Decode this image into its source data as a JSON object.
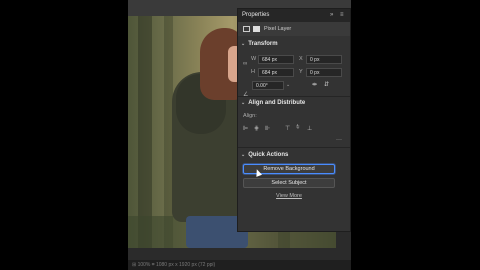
{
  "panel": {
    "title": "Properties",
    "collapse_icon": "double-chevron-icon",
    "menu_icon": "hamburger-icon",
    "layer_type": "Pixel Layer"
  },
  "transform": {
    "title": "Transform",
    "width_label": "W",
    "width_value": "684 px",
    "height_label": "H",
    "height_value": "684 px",
    "x_label": "X",
    "x_value": "0 px",
    "y_label": "Y",
    "y_value": "0 px",
    "angle_value": "0.00°"
  },
  "align": {
    "title": "Align and Distribute",
    "label": "Align:"
  },
  "quick_actions": {
    "title": "Quick Actions",
    "remove_background": "Remove Background",
    "select_subject": "Select Subject",
    "view_more": "View More"
  },
  "status": {
    "text": "⊞ 100% ⌗ 1080 px x 1920 px (72 ppi)"
  },
  "colors": {
    "panel_bg": "#333333",
    "header_bg": "#262626",
    "focus_accent": "#4a8cff"
  }
}
